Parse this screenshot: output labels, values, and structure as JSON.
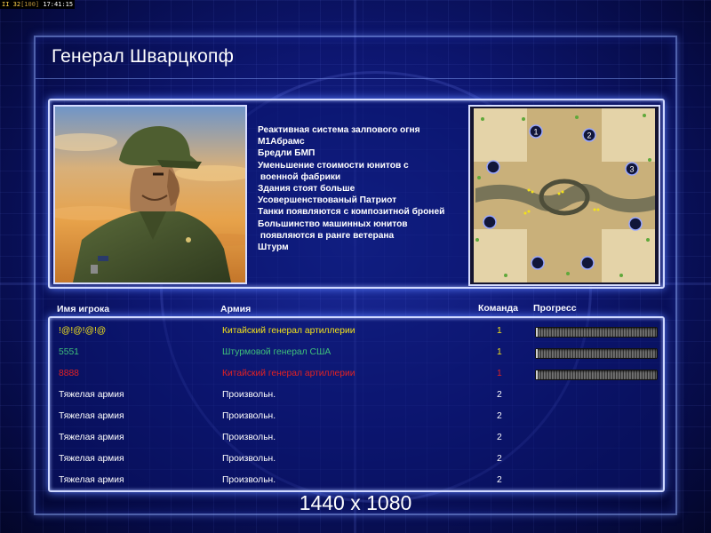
{
  "status_bar": {
    "fps_prefix": "II 32",
    "fps_bracket": "[100]",
    "time": "17:41:15"
  },
  "title": "Генерал Шварцкопф",
  "description_lines": [
    "Реактивная система залпового огня",
    "М1Абрамс",
    "Бредли БМП",
    "Уменьшение стоимости юнитов с",
    " военной фабрики",
    "Здания стоят больше",
    "Усовершенствованый Патриот",
    "Танки появляются с композитной броней",
    "Большинство машинных юнитов",
    " появляются в ранге ветерана",
    "Штурм"
  ],
  "minimap": {
    "start_markers": [
      "1",
      "2",
      "3"
    ]
  },
  "table": {
    "headers": {
      "player": "Имя игрока",
      "army": "Армия",
      "team": "Команда",
      "progress": "Прогресс"
    },
    "rows": [
      {
        "name": "!@!@!@!@",
        "army": "Китайский генерал артиллерии",
        "team": "1",
        "color": "#f2e21a",
        "progress": 0.01
      },
      {
        "name": "5551",
        "army": "Штурмовой генерал США",
        "team": "1",
        "color": "#3fc07a",
        "progress": 0.01
      },
      {
        "name": "8888",
        "army": "Китайский генерал артиллерии",
        "team": "1",
        "color": "#e42222",
        "progress": 0.01
      },
      {
        "name": "Тяжелая армия",
        "army": "Произвольн.",
        "team": "2",
        "color": "#ffffff"
      },
      {
        "name": "Тяжелая армия",
        "army": "Произвольн.",
        "team": "2",
        "color": "#ffffff"
      },
      {
        "name": "Тяжелая армия",
        "army": "Произвольн.",
        "team": "2",
        "color": "#ffffff"
      },
      {
        "name": "Тяжелая армия",
        "army": "Произвольн.",
        "team": "2",
        "color": "#ffffff"
      },
      {
        "name": "Тяжелая армия",
        "army": "Произвольн.",
        "team": "2",
        "color": "#ffffff"
      }
    ]
  },
  "resolution_label": "1440 x 1080"
}
